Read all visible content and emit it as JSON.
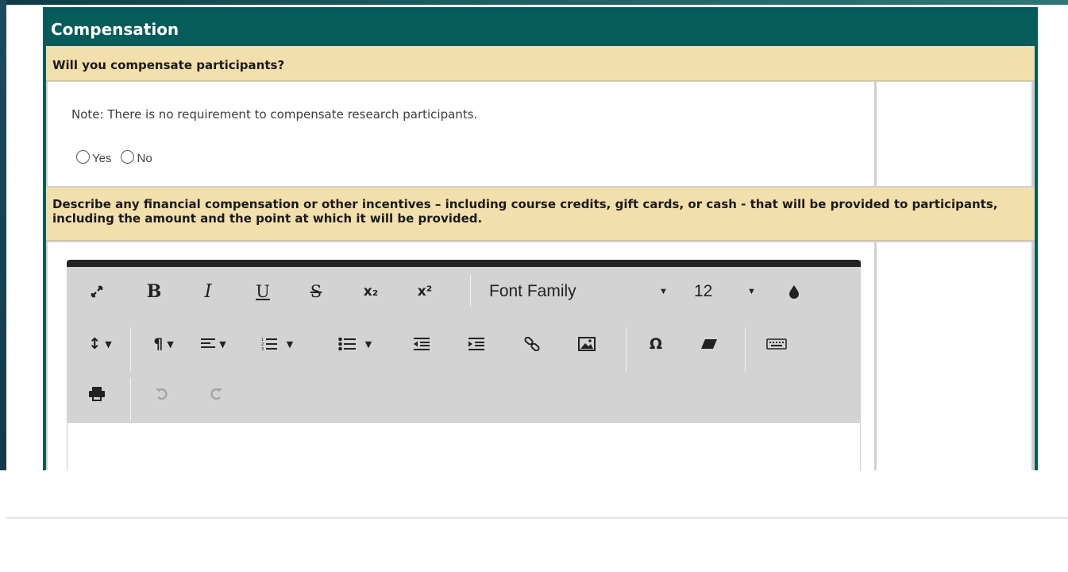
{
  "panel": {
    "title": "Compensation"
  },
  "question1": {
    "label": "Will you compensate participants?",
    "note": "Note: There is no requirement to compensate research participants.",
    "options": [
      "Yes",
      "No"
    ]
  },
  "question2": {
    "label": "Describe any financial compensation or other incentives – including course credits, gift cards, or cash - that will be provided to participants, including the amount and the point at which it will be provided."
  },
  "editor": {
    "font_family": "Font Family",
    "font_size": "12",
    "glyphs": {
      "fullscreen": "⤢",
      "bold": "B",
      "italic": "I",
      "underline": "U",
      "strike": "S",
      "subscript": "x₂",
      "superscript": "x²",
      "line_height": "↕",
      "paragraph": "¶",
      "special_char": "Ω"
    },
    "icons": [
      "expand-icon",
      "bold-icon",
      "italic-icon",
      "underline-icon",
      "strikethrough-icon",
      "subscript-icon",
      "superscript-icon",
      "font-family-dropdown",
      "font-size-dropdown",
      "text-color-icon",
      "line-height-icon",
      "paragraph-format-icon",
      "align-icon",
      "ordered-list-icon",
      "unordered-list-icon",
      "outdent-icon",
      "indent-icon",
      "link-icon",
      "image-icon",
      "special-char-icon",
      "eraser-icon",
      "keyboard-icon",
      "print-icon",
      "undo-icon",
      "redo-icon"
    ]
  }
}
